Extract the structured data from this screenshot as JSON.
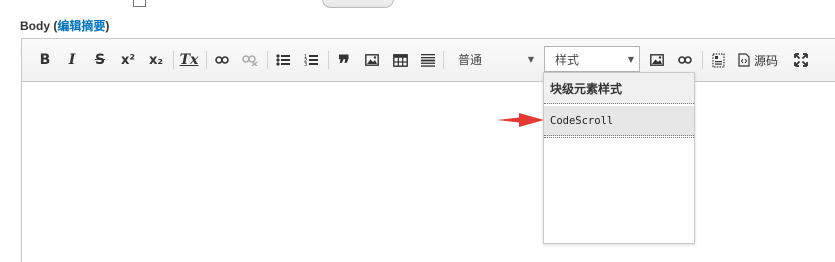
{
  "field": {
    "label": "Body",
    "paren_open": " (",
    "summary_link": "编辑摘要",
    "paren_close": ")"
  },
  "toolbar": {
    "bold": "B",
    "italic": "I",
    "strike": "S",
    "superscript": "x²",
    "subscript": "x₂",
    "remove_format": "Tx",
    "bulleted_list": "☰",
    "numbered_list": "☷",
    "blockquote": "❞",
    "format_value": "普通",
    "styles_value": "样式",
    "source_label": "源码"
  },
  "dropdown": {
    "header": "块级元素样式",
    "items": [
      "CodeScroll"
    ]
  },
  "colors": {
    "link": "#0074bd",
    "arrow": "#e53935",
    "toolbar_bg": "#f5f5f5",
    "selected_item_bg": "#e6e6e6"
  }
}
